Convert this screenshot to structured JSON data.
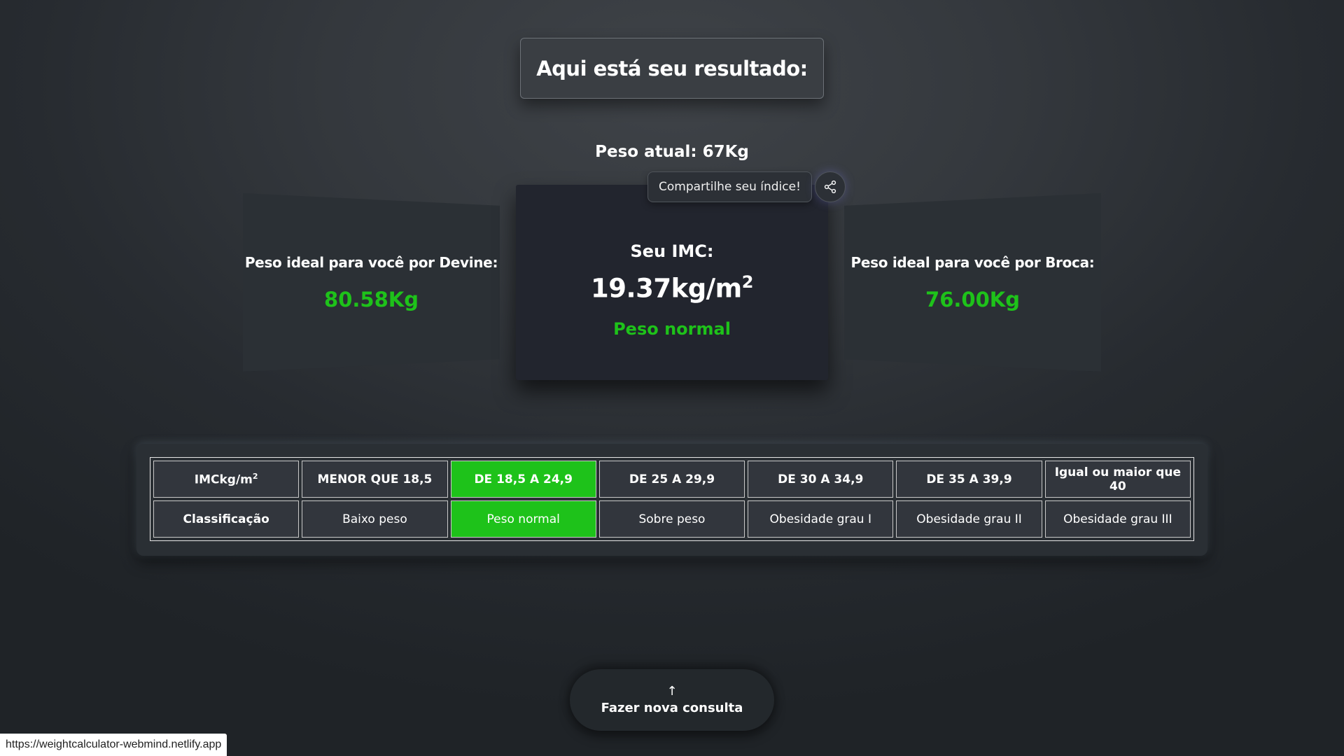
{
  "header": {
    "title": "Aqui está seu resultado:"
  },
  "current_weight": "Peso atual: 67Kg",
  "share": {
    "label": "Compartilhe seu índice!",
    "icon": "share-icon"
  },
  "cards": {
    "devine": {
      "title": "Peso ideal para você por Devine:",
      "value": "80.58Kg"
    },
    "imc": {
      "label": "Seu IMC:",
      "value": "19.37kg/m",
      "exponent": "2",
      "classification": "Peso normal"
    },
    "broca": {
      "title": "Peso ideal para você por Broca:",
      "value": "76.00Kg"
    }
  },
  "table": {
    "header_label": "IMCkg/m",
    "header_exponent": "2",
    "row_label": "Classificação",
    "ranges": [
      "MENOR QUE 18,5",
      "DE 18,5 A 24,9",
      "DE 25 A 29,9",
      "DE 30 A 34,9",
      "DE 35 A 39,9",
      "Igual ou maior que 40"
    ],
    "classes": [
      "Baixo peso",
      "Peso normal",
      "Sobre peso",
      "Obesidade grau I",
      "Obesidade grau II",
      "Obesidade grau III"
    ],
    "highlight_color": "#1ec21a"
  },
  "new_query": {
    "label": "Fazer nova consulta",
    "icon": "arrow-up-icon"
  },
  "status_bar": {
    "url": "https://weightcalculator-webmind.netlify.app"
  },
  "colors": {
    "accent_green": "#1ec21a",
    "card_bg": "#2b3035",
    "center_card_bg": "#22252e"
  }
}
